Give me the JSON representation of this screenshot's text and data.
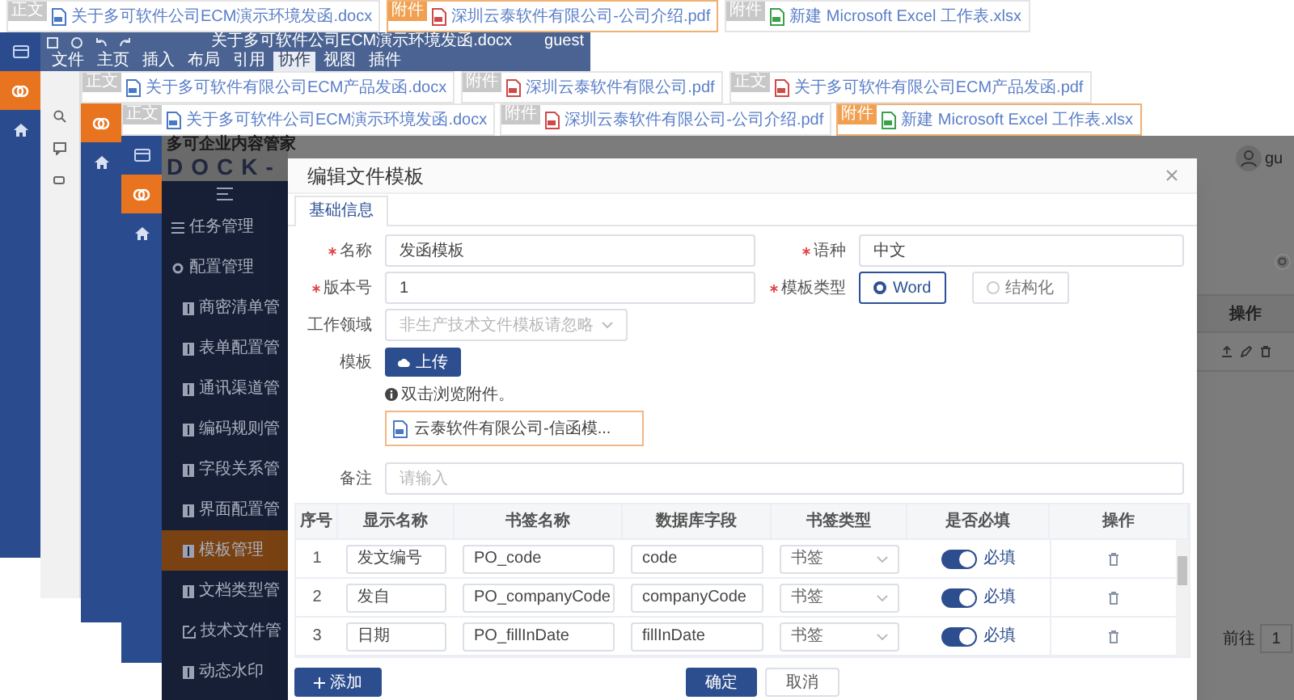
{
  "top_file_tabs": [
    {
      "badge": "正文",
      "kind": "word",
      "name": "关于多可软件公司ECM演示环境发函.docx",
      "selected": false
    },
    {
      "badge": "附件",
      "kind": "pdf",
      "name": "深圳云泰软件有限公司-公司介绍.pdf",
      "selected": true
    },
    {
      "badge": "附件",
      "kind": "excel",
      "name": "新建 Microsoft Excel 工作表.xlsx",
      "selected": false
    }
  ],
  "word_window": {
    "title": "关于多可软件公司ECM演示环境发函.docx",
    "user": "guest",
    "menu": [
      {
        "label": "文件",
        "selected": false
      },
      {
        "label": "主页",
        "selected": false
      },
      {
        "label": "插入",
        "selected": false
      },
      {
        "label": "布局",
        "selected": false
      },
      {
        "label": "引用",
        "selected": false
      },
      {
        "label": "协作",
        "selected": true
      },
      {
        "label": "视图",
        "selected": false
      },
      {
        "label": "插件",
        "selected": false
      }
    ]
  },
  "middle_file_tabs": [
    {
      "badge": "正文",
      "kind": "word",
      "name": "关于多可软件有限公司ECM产品发函.docx",
      "selected": false
    },
    {
      "badge": "附件",
      "kind": "pdf",
      "name": "深圳云泰软件有限公司.pdf",
      "selected": false
    },
    {
      "badge": "正文",
      "kind": "pdf",
      "name": "关于多可软件有限公司ECM产品发函.pdf",
      "selected": false
    }
  ],
  "lower_file_tabs": [
    {
      "badge": "正文",
      "kind": "word",
      "name": "关于多可软件公司ECM演示环境发函.docx",
      "selected": false
    },
    {
      "badge": "附件",
      "kind": "pdf",
      "name": "深圳云泰软件有限公司-公司介绍.pdf",
      "selected": false
    },
    {
      "badge": "附件",
      "kind": "excel",
      "name": "新建 Microsoft Excel 工作表.xlsx",
      "selected": true
    }
  ],
  "app": {
    "logo_text": "多可企业内容管家",
    "logo_mark": "DOCK-",
    "user": "gu",
    "sidebar": {
      "items": [
        {
          "label": "任务管理",
          "kind": "tasks",
          "selected": false
        },
        {
          "label": "配置管理",
          "kind": "settings",
          "selected": false
        },
        {
          "label": "商密清单管",
          "kind": "page",
          "selected": false
        },
        {
          "label": "表单配置管",
          "kind": "page",
          "selected": false
        },
        {
          "label": "通讯渠道管",
          "kind": "page",
          "selected": false
        },
        {
          "label": "编码规则管",
          "kind": "page",
          "selected": false
        },
        {
          "label": "字段关系管",
          "kind": "page",
          "selected": false
        },
        {
          "label": "界面配置管",
          "kind": "page",
          "selected": false
        },
        {
          "label": "模板管理",
          "kind": "page",
          "selected": true
        },
        {
          "label": "文档类型管",
          "kind": "page",
          "selected": false
        },
        {
          "label": "技术文件管",
          "kind": "editor",
          "selected": false
        },
        {
          "label": "动态水印",
          "kind": "page",
          "selected": false
        }
      ]
    },
    "table_header": "操作",
    "pagination": {
      "goto": "前往",
      "page": "1"
    }
  },
  "dialog": {
    "title": "编辑文件模板",
    "tabs": [
      {
        "label": "基础信息",
        "selected": true
      }
    ],
    "name": {
      "label": "名称",
      "required": true,
      "value": "发函模板"
    },
    "version": {
      "label": "版本号",
      "required": true,
      "value": "1"
    },
    "domain": {
      "label": "工作领域",
      "required": false,
      "placeholder": "非生产技术文件模板请忽略"
    },
    "language": {
      "label": "语种",
      "required": true,
      "value": "中文"
    },
    "template_type": {
      "label": "模板类型",
      "required": true,
      "options": [
        {
          "label": "Word",
          "selected": true
        },
        {
          "label": "结构化",
          "selected": false
        }
      ]
    },
    "template": {
      "label": "模板",
      "upload_button": "上传",
      "hint": "双击浏览附件。",
      "file": "云泰软件有限公司-信函模..."
    },
    "remark": {
      "label": "备注",
      "placeholder": "请输入"
    },
    "table": {
      "columns": [
        "序号",
        "显示名称",
        "书签名称",
        "数据库字段",
        "书签类型",
        "是否必填",
        "操作"
      ],
      "rows": [
        {
          "index": "1",
          "display_name": "发文编号",
          "bookmark": "PO_code",
          "db_field": "code",
          "bookmark_type": "书签",
          "required": true,
          "required_label": "必填"
        },
        {
          "index": "2",
          "display_name": "发自",
          "bookmark": "PO_companyCode",
          "db_field": "companyCode",
          "bookmark_type": "书签",
          "required": true,
          "required_label": "必填"
        },
        {
          "index": "3",
          "display_name": "日期",
          "bookmark": "PO_fillInDate",
          "db_field": "fillInDate",
          "bookmark_type": "书签",
          "required": true,
          "required_label": "必填"
        }
      ]
    },
    "add_button": "添加",
    "confirm_button": "确定",
    "cancel_button": "取消"
  }
}
